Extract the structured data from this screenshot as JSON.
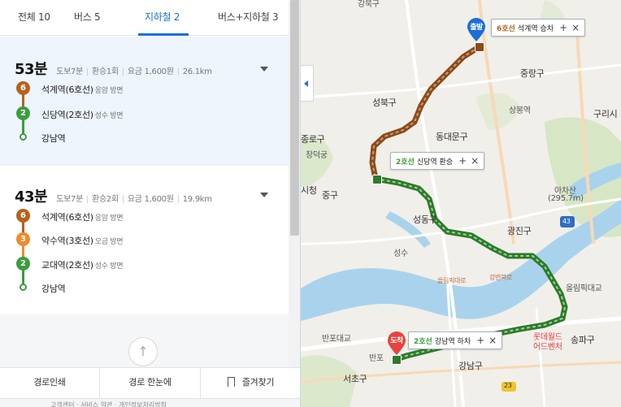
{
  "tabs": [
    {
      "label": "전체 10"
    },
    {
      "label": "버스 5"
    },
    {
      "label": "지하철 2"
    },
    {
      "label": "버스+지하철 3"
    }
  ],
  "routes": [
    {
      "time": "53분",
      "walk": "도보7분",
      "transfer": "환승1회",
      "fare": "요금 1,600원",
      "distance": "26.1km",
      "stops": [
        {
          "line": "6",
          "name": "석계역(6호선)",
          "direction": "응암 방면",
          "color": "#b5631f"
        },
        {
          "line": "2",
          "name": "신당역(2호선)",
          "direction": "성수 방면",
          "color": "#3b9d3b"
        },
        {
          "line": "",
          "name": "강남역",
          "direction": "",
          "color": "#3b9d3b"
        }
      ]
    },
    {
      "time": "43분",
      "walk": "도보7분",
      "transfer": "환승2회",
      "fare": "요금 1,600원",
      "distance": "19.9km",
      "stops": [
        {
          "line": "6",
          "name": "석계역(6호선)",
          "direction": "응암 방면",
          "color": "#b5631f"
        },
        {
          "line": "3",
          "name": "약수역(3호선)",
          "direction": "오금 방면",
          "color": "#f08b2c"
        },
        {
          "line": "2",
          "name": "교대역(2호선)",
          "direction": "성수 방면",
          "color": "#3b9d3b"
        },
        {
          "line": "",
          "name": "강남역",
          "direction": "",
          "color": "#3b9d3b"
        }
      ]
    }
  ],
  "bottom_bar": {
    "print": "경로인쇄",
    "overview": "경로 한눈에",
    "bookmark": "즐겨찾기"
  },
  "footer_text": "고객센터 · 서비스 약관 · 개인정보처리방침",
  "map": {
    "callouts": {
      "start": {
        "line": "6호선",
        "station": "석계역",
        "action": "승차",
        "line_color": "#b5631f"
      },
      "transfer": {
        "line": "2호선",
        "station": "신당역",
        "action": "환승",
        "line_color": "#3b9d3b"
      },
      "end": {
        "line": "2호선",
        "station": "강남역",
        "action": "하차",
        "line_color": "#3b9d3b"
      }
    },
    "pins": {
      "start": {
        "label": "출발",
        "color": "#1a6ed8"
      },
      "end": {
        "label": "도착",
        "color": "#e8433e"
      }
    },
    "labels": {
      "gangbuk": "강북구",
      "jungnang": "중랑구",
      "sangbong": "상봉역",
      "seongbuk": "성북구",
      "guri": "구리시",
      "dongdaemun": "동대문구",
      "jongno": "종로구",
      "changdeok": "창덕궁",
      "cityhall": "시청",
      "jung": "중구",
      "achasan": "아차산",
      "achasan_alt": "(295.7m)",
      "seongdong": "성동구",
      "gwangjin": "광진구",
      "seongsu": "성수",
      "olympic_road": "올림픽대로",
      "gangbyeon_road": "강변북로",
      "jamsil": "잠실대교",
      "olympic_bridge": "올림픽대교",
      "banpo_bridge": "반포대교",
      "banpo": "반포",
      "lotte": "롯데월드",
      "lotte2": "어드벤처",
      "songpa": "송파구",
      "seocho": "서초구",
      "gangnam": "강남구",
      "route_43": "43",
      "route_23": "23"
    }
  }
}
